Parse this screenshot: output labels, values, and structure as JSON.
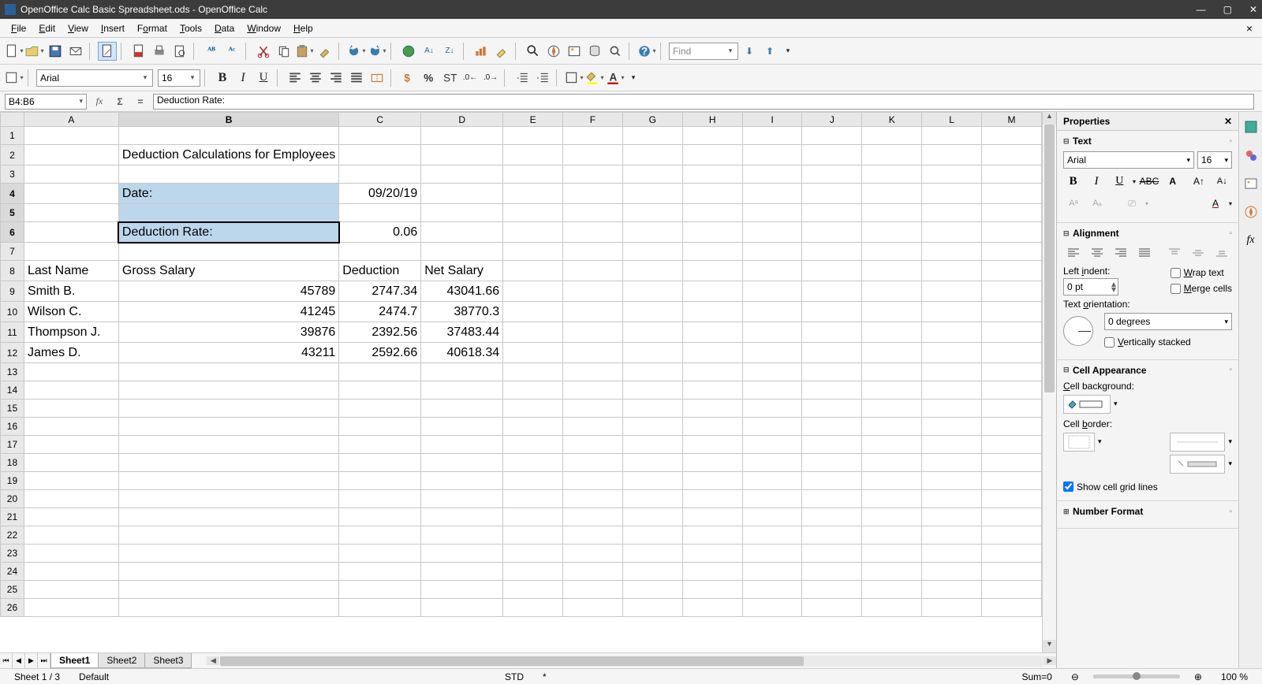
{
  "window": {
    "title": "OpenOffice Calc Basic Spreadsheet.ods - OpenOffice Calc"
  },
  "menu": {
    "file": "File",
    "edit": "Edit",
    "view": "View",
    "insert": "Insert",
    "format": "Format",
    "tools": "Tools",
    "data": "Data",
    "window": "Window",
    "help": "Help"
  },
  "toolbar": {
    "find_placeholder": "Find"
  },
  "fontbar": {
    "font_name": "Arial",
    "font_size": "16"
  },
  "formula_bar": {
    "cell_ref": "B4:B6",
    "formula": "Deduction Rate:"
  },
  "columns": [
    "A",
    "B",
    "C",
    "D",
    "E",
    "F",
    "G",
    "H",
    "I",
    "J",
    "K",
    "L",
    "M"
  ],
  "row_count": 26,
  "cells": {
    "B2": "Deduction Calculations for Employees",
    "B4": "Date:",
    "C4": "09/20/19",
    "B6": "Deduction Rate:",
    "C6": "0.06",
    "A8": "Last Name",
    "B8": "Gross Salary",
    "C8": "Deduction",
    "D8": "Net Salary",
    "A9": "Smith B.",
    "B9": "45789",
    "C9": "2747.34",
    "D9": "43041.66",
    "A10": "Wilson C.",
    "B10": "41245",
    "C10": "2474.7",
    "D10": "38770.3",
    "A11": "Thompson J.",
    "B11": "39876",
    "C11": "2392.56",
    "D11": "37483.44",
    "A12": "James D.",
    "B12": "43211",
    "C12": "2592.66",
    "D12": "40618.34"
  },
  "selected_column": "B",
  "selected_rows": [
    4,
    5,
    6
  ],
  "active_cell": "B6",
  "tabs": {
    "items": [
      "Sheet1",
      "Sheet2",
      "Sheet3"
    ],
    "active": 0
  },
  "statusbar": {
    "sheet": "Sheet 1 / 3",
    "style": "Default",
    "mode": "STD",
    "modified": "*",
    "sum": "Sum=0",
    "zoom": "100 %"
  },
  "properties": {
    "title": "Properties",
    "text": {
      "title": "Text",
      "font": "Arial",
      "size": "16"
    },
    "alignment": {
      "title": "Alignment",
      "indent_label": "Left indent:",
      "indent_value": "0 pt",
      "wrap": "Wrap text",
      "merge": "Merge cells",
      "orient_label": "Text orientation:",
      "orient_value": "0 degrees",
      "vstack": "Vertically stacked"
    },
    "appearance": {
      "title": "Cell Appearance",
      "bg_label": "Cell background:",
      "border_label": "Cell border:",
      "grid": "Show cell grid lines"
    },
    "number": {
      "title": "Number Format"
    }
  }
}
